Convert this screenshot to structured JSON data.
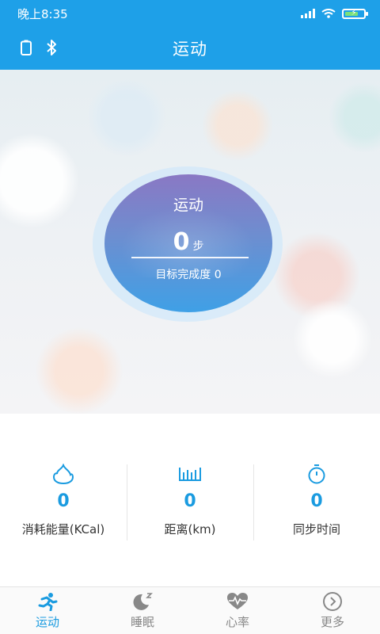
{
  "status_bar": {
    "time": "晚上8:35"
  },
  "header": {
    "title": "运动",
    "left_icons": [
      "battery-icon",
      "bluetooth-icon"
    ]
  },
  "hero": {
    "circle_title": "运动",
    "steps": "0",
    "steps_unit": "步",
    "goal_label": "目标完成度",
    "goal_value": "0"
  },
  "stats": [
    {
      "icon": "fire-icon",
      "value": "0",
      "label": "消耗能量(KCal)"
    },
    {
      "icon": "ruler-icon",
      "value": "0",
      "label": "距离(km)"
    },
    {
      "icon": "stopwatch-icon",
      "value": "0",
      "label": "同步时间"
    }
  ],
  "nav": [
    {
      "label": "运动",
      "icon": "running-icon",
      "active": true
    },
    {
      "label": "睡眠",
      "icon": "moon-icon",
      "active": false
    },
    {
      "label": "心率",
      "icon": "heart-icon",
      "active": false
    },
    {
      "label": "更多",
      "icon": "more-icon",
      "active": false
    }
  ],
  "colors": {
    "primary": "#1ea0e8",
    "accent": "#1a9be0",
    "inactive": "#888888"
  }
}
